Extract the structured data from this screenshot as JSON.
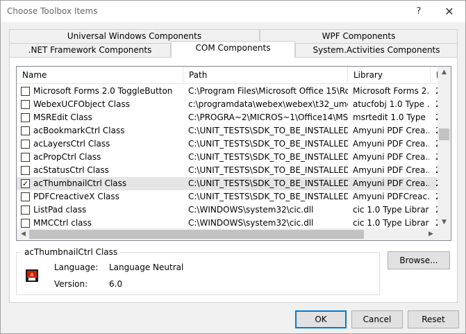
{
  "window": {
    "title": "Choose Toolbox Items",
    "help_glyph": "?",
    "close_glyph": "✕"
  },
  "tabs": {
    "row1": [
      "Universal Windows Components",
      "WPF Components"
    ],
    "row2": [
      ".NET Framework Components",
      "COM Components",
      "System.Activities Components"
    ],
    "active": "COM Components"
  },
  "list": {
    "columns": [
      "Name",
      "Path",
      "Library",
      "L"
    ],
    "rows": [
      {
        "checked": false,
        "name": "Microsoft Forms 2.0 ToggleButton",
        "path": "C:\\Program Files\\Microsoft Office 15\\Ro...",
        "library": "Microsoft Forms 2...",
        "extra": "2"
      },
      {
        "checked": false,
        "name": "WebexUCFObject Class",
        "path": "c:\\programdata\\webex\\webex\\t32_umc\\...",
        "library": "atucfobj 1.0 Type ...",
        "extra": "2"
      },
      {
        "checked": false,
        "name": "MSREdit Class",
        "path": "C:\\PROGRA~2\\MICROS~1\\Office14\\MS...",
        "library": "msrtedit 1.0 Type ...",
        "extra": "2"
      },
      {
        "checked": false,
        "name": "acBookmarkCtrl Class",
        "path": "C:\\UNIT_TESTS\\SDK_TO_BE_INSTALLED\\...",
        "library": "Amyuni PDF Crea...",
        "extra": "2"
      },
      {
        "checked": false,
        "name": "acLayersCtrl Class",
        "path": "C:\\UNIT_TESTS\\SDK_TO_BE_INSTALLED\\...",
        "library": "Amyuni PDF Crea...",
        "extra": "2"
      },
      {
        "checked": false,
        "name": "acPropCtrl Class",
        "path": "C:\\UNIT_TESTS\\SDK_TO_BE_INSTALLED\\...",
        "library": "Amyuni PDF Crea...",
        "extra": "2"
      },
      {
        "checked": false,
        "name": "acStatusCtrl Class",
        "path": "C:\\UNIT_TESTS\\SDK_TO_BE_INSTALLED\\...",
        "library": "Amyuni PDF Crea...",
        "extra": "2"
      },
      {
        "checked": true,
        "name": "acThumbnailCtrl Class",
        "path": "C:\\UNIT_TESTS\\SDK_TO_BE_INSTALLED\\...",
        "library": "Amyuni PDF Crea...",
        "extra": "2"
      },
      {
        "checked": false,
        "name": "PDFCreactiveX Class",
        "path": "C:\\UNIT_TESTS\\SDK_TO_BE_INSTALLED\\...",
        "library": "Amyuni PDFCreac...",
        "extra": "2"
      },
      {
        "checked": false,
        "name": "ListPad class",
        "path": "C:\\WINDOWS\\system32\\cic.dll",
        "library": "cic 1.0 Type Library",
        "extra": "2"
      },
      {
        "checked": false,
        "name": "MMCCtrl class",
        "path": "C:\\WINDOWS\\system32\\cic.dll",
        "library": "cic 1.0 Type Library",
        "extra": "2"
      }
    ],
    "selected_index": 7
  },
  "details": {
    "group_title": "acThumbnailCtrl Class",
    "language_label": "Language:",
    "language_value": "Language Neutral",
    "version_label": "Version:",
    "version_value": "6.0"
  },
  "buttons": {
    "browse": "Browse...",
    "ok": "OK",
    "cancel": "Cancel",
    "reset": "Reset"
  },
  "colors": {
    "selected_row": "#e5e5e5",
    "accent": "#0078d7"
  }
}
